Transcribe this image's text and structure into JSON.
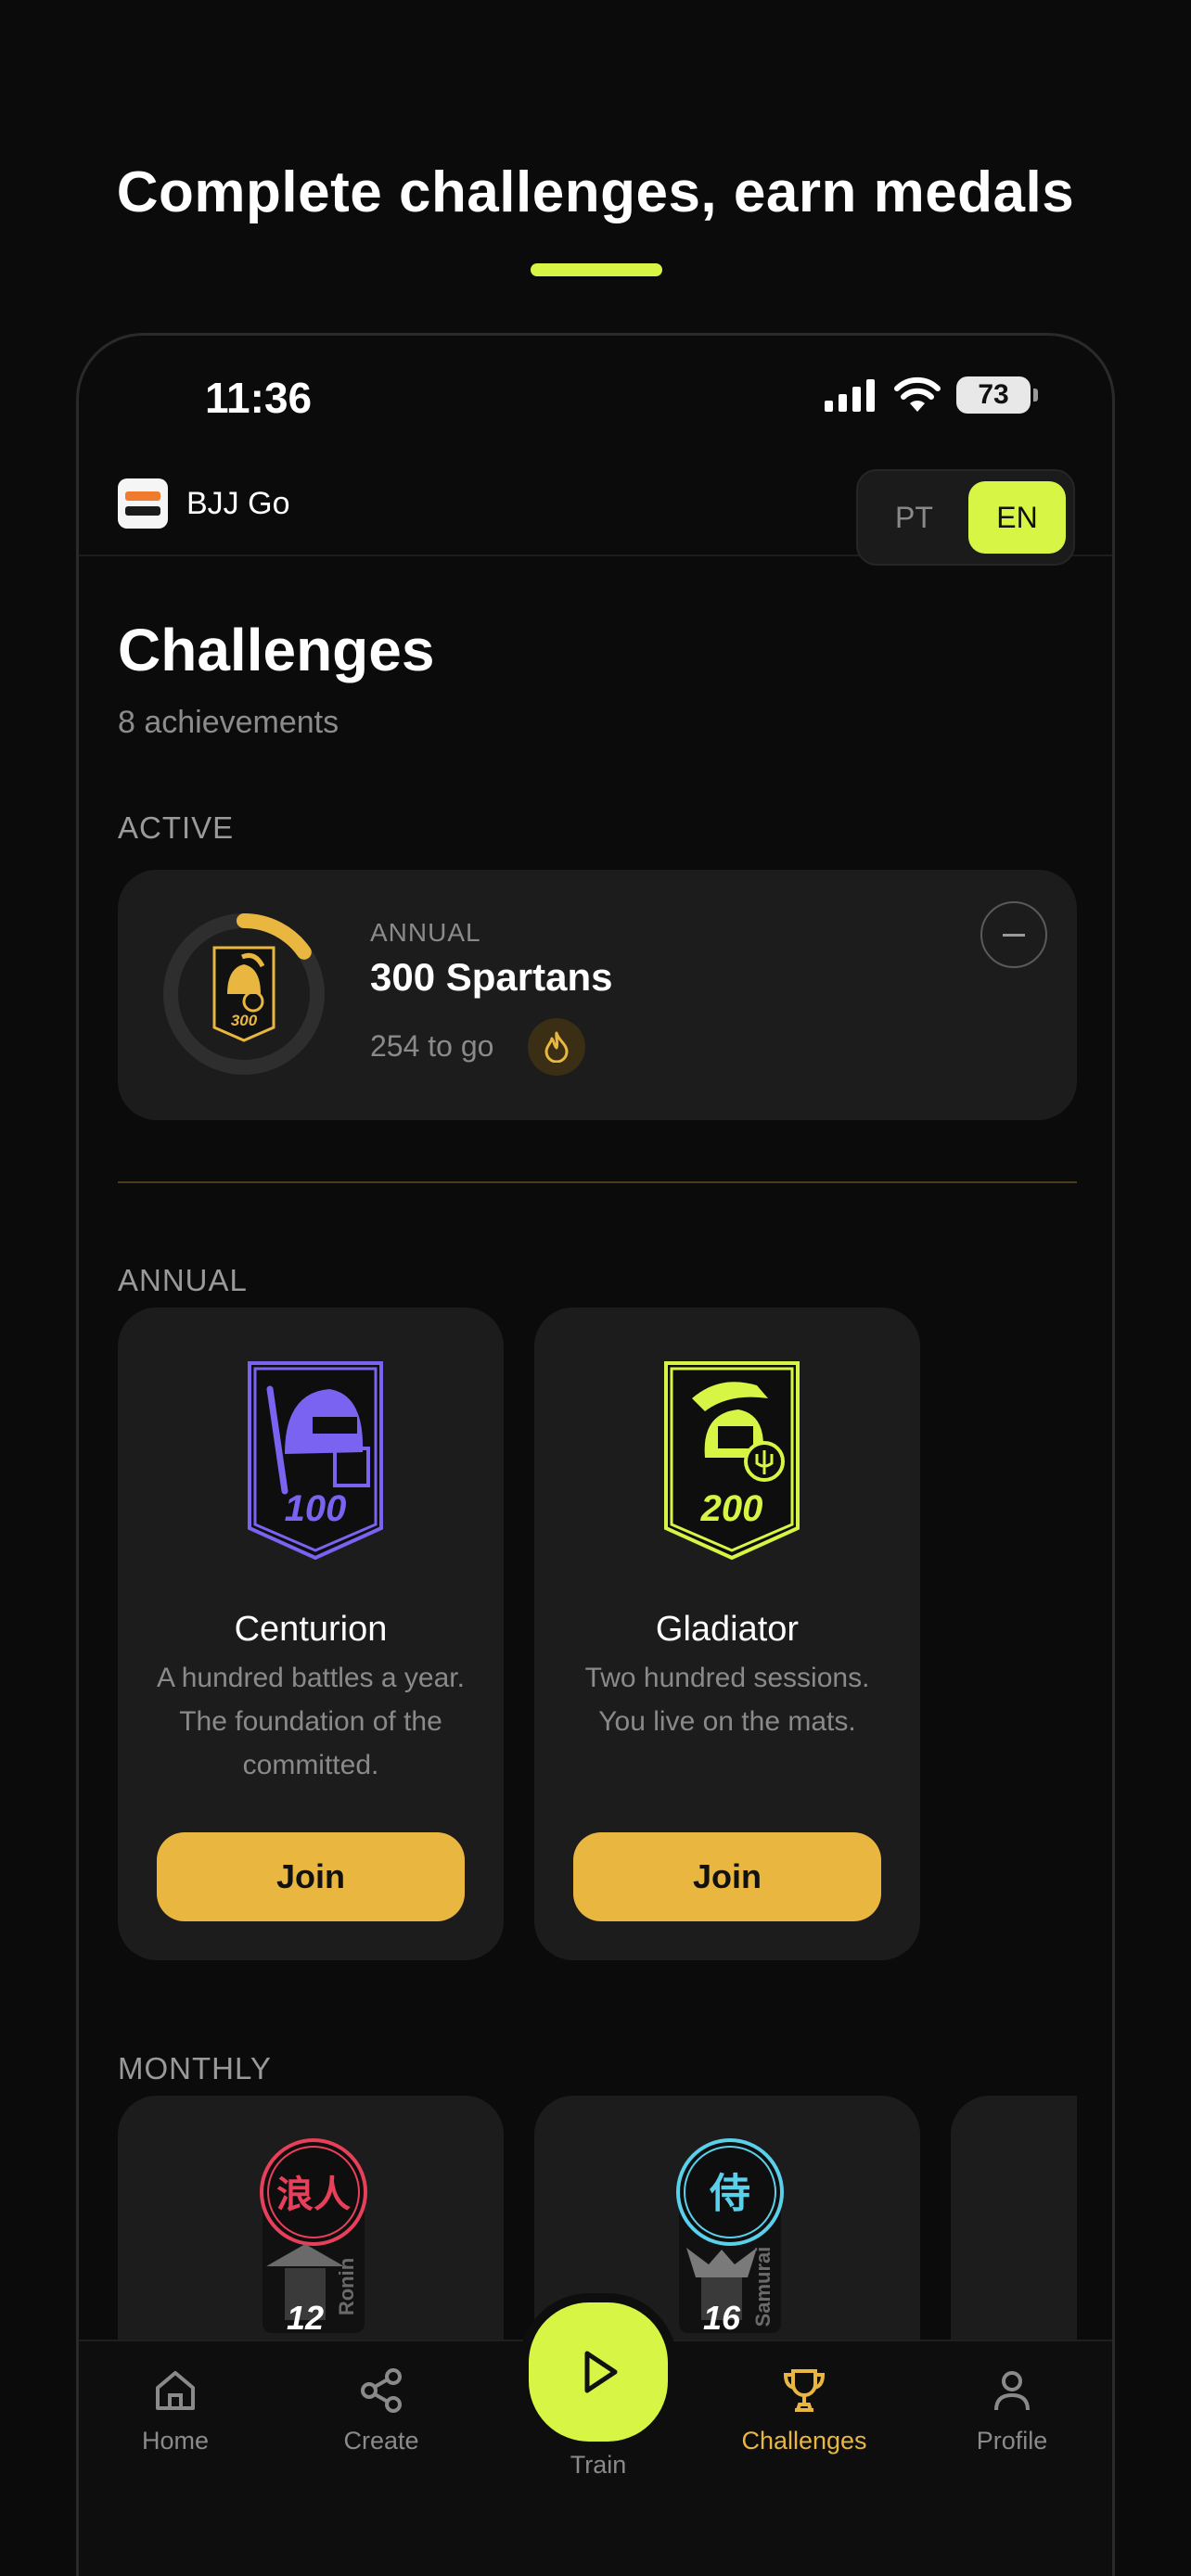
{
  "promo": {
    "headline": "Complete challenges, earn medals"
  },
  "status_bar": {
    "time": "11:36",
    "battery": "73"
  },
  "app": {
    "name": "BJJ Go"
  },
  "language": {
    "options": [
      "PT",
      "EN"
    ],
    "selected": "EN"
  },
  "page": {
    "title": "Challenges",
    "subtitle": "8 achievements"
  },
  "sections": {
    "active": "ACTIVE",
    "annual": "ANNUAL",
    "monthly": "MONTHLY"
  },
  "active_challenge": {
    "period": "ANNUAL",
    "name": "300 Spartans",
    "remaining": "254 to go",
    "badge_number": "300",
    "progress": 0.153,
    "accent": "#e9b740"
  },
  "annual_challenges": [
    {
      "name": "Centurion",
      "description": "A hundred battles a year. The foundation of the committed.",
      "badge_number": "100",
      "color": "#7a63f0",
      "action": "Join"
    },
    {
      "name": "Gladiator",
      "description": "Two hundred sessions. You live on the mats.",
      "badge_number": "200",
      "color": "#d7f545",
      "action": "Join"
    }
  ],
  "monthly_challenges": [
    {
      "name": "Ronin",
      "kanji": "浪人",
      "badge_number": "12",
      "color": "#e8405a"
    },
    {
      "name": "Samurai",
      "kanji": "侍",
      "badge_number": "16",
      "color": "#5ad0ea"
    }
  ],
  "tabs": [
    {
      "label": "Home",
      "icon": "home-icon"
    },
    {
      "label": "Create",
      "icon": "share-icon"
    },
    {
      "label": "Train",
      "icon": "play-icon"
    },
    {
      "label": "Challenges",
      "icon": "trophy-icon",
      "active": true
    },
    {
      "label": "Profile",
      "icon": "user-icon"
    }
  ],
  "colors": {
    "accent_lime": "#d7f545",
    "accent_gold": "#e9b740",
    "card_bg": "#1c1c1c"
  }
}
